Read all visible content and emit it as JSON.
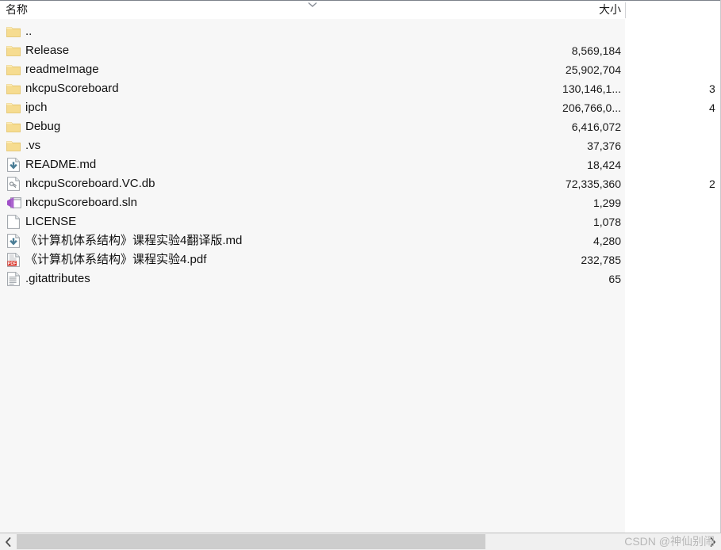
{
  "header": {
    "name_label": "名称",
    "size_label": "大小",
    "sort_caret_icon": "chevron-down-icon"
  },
  "scrollbar": {
    "left_arrow_icon": "chevron-left-icon",
    "right_arrow_icon": "chevron-right-icon"
  },
  "watermark": {
    "text": "CSDN @神仙别闹"
  },
  "colors": {
    "folder": "#f6dc90",
    "pane_name_bg": "#f7f7f7",
    "pane_size_bg": "#ffffff",
    "header_border": "#7c818a",
    "scrollbar_thumb": "#cdcdcd",
    "pdf_red": "#d93025",
    "vs_purple": "#a050c8",
    "md_blue": "#4a7d96"
  },
  "rows": [
    {
      "name": "..",
      "icon": "folder-icon",
      "size": "",
      "extra": ""
    },
    {
      "name": "Release",
      "icon": "folder-icon",
      "size": "8,569,184",
      "extra": ""
    },
    {
      "name": "readmeImage",
      "icon": "folder-icon",
      "size": "25,902,704",
      "extra": ""
    },
    {
      "name": "nkcpuScoreboard",
      "icon": "folder-icon",
      "size": "130,146,1...",
      "extra": "3"
    },
    {
      "name": "ipch",
      "icon": "folder-icon",
      "size": "206,766,0...",
      "extra": "4"
    },
    {
      "name": "Debug",
      "icon": "folder-icon",
      "size": "6,416,072",
      "extra": ""
    },
    {
      "name": ".vs",
      "icon": "folder-icon",
      "size": "37,376",
      "extra": ""
    },
    {
      "name": "README.md",
      "icon": "markdown-icon",
      "size": "18,424",
      "extra": ""
    },
    {
      "name": "nkcpuScoreboard.VC.db",
      "icon": "database-icon",
      "size": "72,335,360",
      "extra": "2"
    },
    {
      "name": "nkcpuScoreboard.sln",
      "icon": "solution-icon",
      "size": "1,299",
      "extra": ""
    },
    {
      "name": "LICENSE",
      "icon": "blank-file-icon",
      "size": "1,078",
      "extra": ""
    },
    {
      "name": "《计算机体系结构》课程实验4翻译版.md",
      "icon": "markdown-icon",
      "size": "4,280",
      "extra": ""
    },
    {
      "name": "《计算机体系结构》课程实验4.pdf",
      "icon": "pdf-icon",
      "size": "232,785",
      "extra": ""
    },
    {
      "name": ".gitattributes",
      "icon": "text-file-icon",
      "size": "65",
      "extra": ""
    }
  ]
}
